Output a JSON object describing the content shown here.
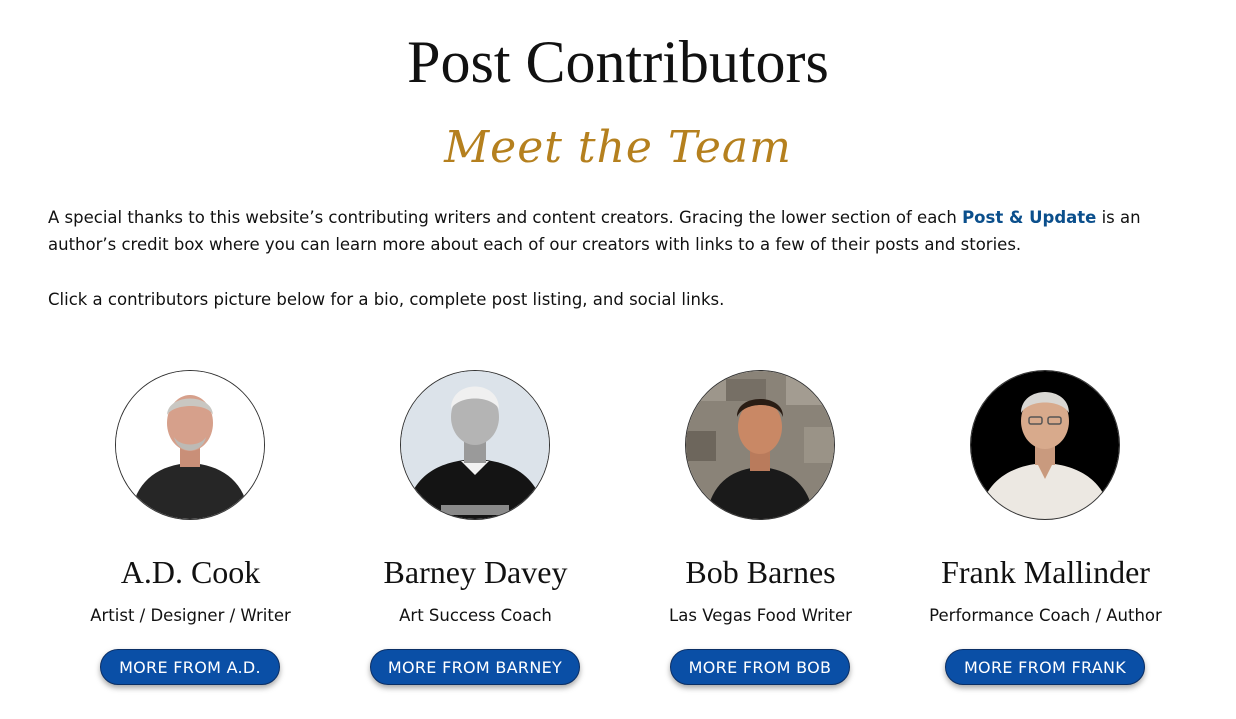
{
  "page": {
    "title": "Post Contributors",
    "subtitle": "Meet the Team",
    "intro": {
      "before_link": "A special thanks to this website’s contributing writers and content creators. Gracing the lower section of each ",
      "link_text": "Post & Update",
      "after_link": " is an author’s credit box where you can learn more about each of our creators with links to a few of their posts and stories."
    },
    "instruction": "Click a contributors picture below for a bio, complete post listing, and social links."
  },
  "contributors": [
    {
      "name": "A.D. Cook",
      "role": "Artist / Designer / Writer",
      "button_label": "MORE FROM A.D."
    },
    {
      "name": "Barney Davey",
      "role": "Art Success Coach",
      "button_label": "MORE FROM BARNEY"
    },
    {
      "name": "Bob Barnes",
      "role": "Las Vegas Food Writer",
      "button_label": "MORE FROM BOB"
    },
    {
      "name": "Frank Mallinder",
      "role": "Performance Coach / Author",
      "button_label": "MORE FROM FRANK"
    }
  ],
  "colors": {
    "accent_script": "#b5801e",
    "link": "#0b4f8c",
    "button": "#0a4fa6"
  }
}
